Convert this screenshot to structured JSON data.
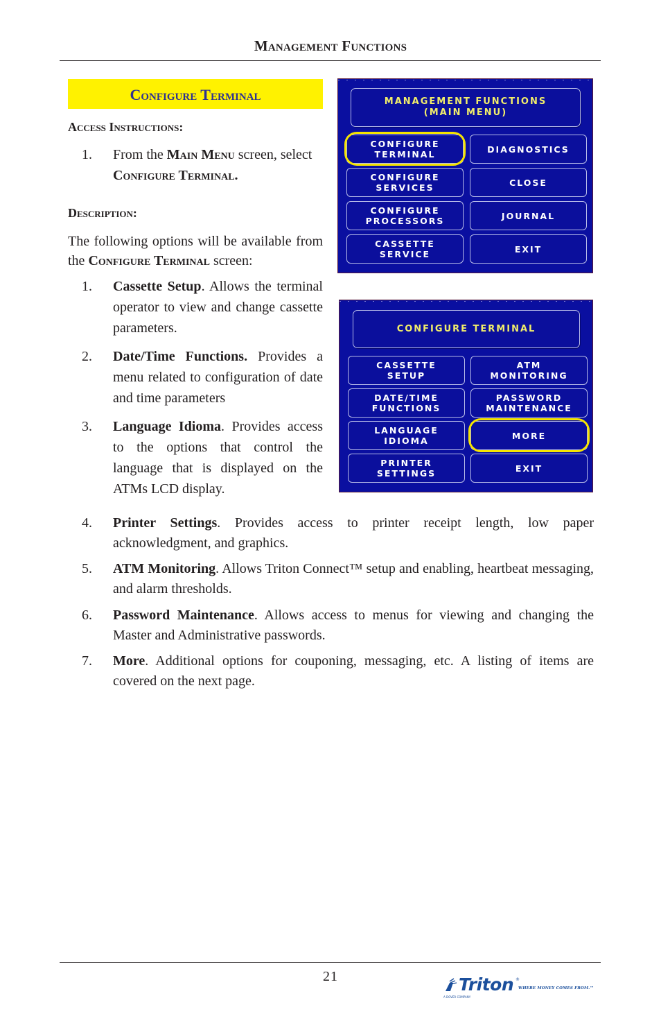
{
  "header": {
    "title": "Management Functions"
  },
  "section": {
    "title": "Configure Terminal"
  },
  "access": {
    "heading": "Access Instructions:",
    "steps": [
      {
        "num": "1.",
        "pre": "From the ",
        "sc1": "Main Menu",
        "mid": " screen, select ",
        "sc2": "Configure Terminal",
        "post": "."
      }
    ]
  },
  "description": {
    "heading": "Description:",
    "intro_pre": "The following options will be available from the ",
    "intro_sc": "Configure Terminal",
    "intro_post": " screen:",
    "items": [
      {
        "num": "1.",
        "bold": "Cassette Setup",
        "text": ". Allows the terminal operator to view and change cassette parameters."
      },
      {
        "num": "2.",
        "bold": "Date/Time Functions.",
        "text": " Provides a menu related to configuration of date and time parameters"
      },
      {
        "num": "3.",
        "bold": "Language Idioma",
        "text": ". Provides access to the options that control the language that is displayed on the ATMs LCD display."
      },
      {
        "num": "4.",
        "bold": "Printer Settings",
        "text": ". Provides access to printer receipt length, low paper acknowledgment, and graphics."
      },
      {
        "num": "5.",
        "bold": "ATM Monitoring",
        "text": ". Allows Triton Connect™ setup and enabling, heartbeat messaging, and alarm thresholds."
      },
      {
        "num": "6.",
        "bold": "Password Maintenance",
        "text": ". Allows access to menus for viewing and changing the Master and Administrative passwords."
      },
      {
        "num": "7.",
        "bold": "More",
        "text": ". Additional options for couponing, messaging, etc. A listing of items are covered on the next page."
      }
    ]
  },
  "screens": {
    "main_menu": {
      "title_line1": "MANAGEMENT FUNCTIONS",
      "title_line2": "(MAIN MENU)",
      "buttons": [
        {
          "line1": "CONFIGURE",
          "line2": "TERMINAL",
          "highlighted": true
        },
        {
          "line1": "DIAGNOSTICS",
          "line2": ""
        },
        {
          "line1": "CONFIGURE",
          "line2": "SERVICES"
        },
        {
          "line1": "CLOSE",
          "line2": ""
        },
        {
          "line1": "CONFIGURE",
          "line2": "PROCESSORS"
        },
        {
          "line1": "JOURNAL",
          "line2": ""
        },
        {
          "line1": "CASSETTE",
          "line2": "SERVICE"
        },
        {
          "line1": "EXIT",
          "line2": ""
        }
      ]
    },
    "configure_terminal": {
      "title_line1": "CONFIGURE TERMINAL",
      "buttons": [
        {
          "line1": "CASSETTE",
          "line2": "SETUP"
        },
        {
          "line1": "ATM",
          "line2": "MONITORING"
        },
        {
          "line1": "DATE/TIME",
          "line2": "FUNCTIONS"
        },
        {
          "line1": "PASSWORD",
          "line2": "MAINTENANCE"
        },
        {
          "line1": "LANGUAGE",
          "line2": "IDIOMA"
        },
        {
          "line1": "MORE",
          "line2": "",
          "highlighted": true
        },
        {
          "line1": "PRINTER",
          "line2": "SETTINGS"
        },
        {
          "line1": "EXIT",
          "line2": ""
        }
      ]
    },
    "colors": {
      "screen_bg": "#0a0fa0",
      "title_text": "#f2ee6a",
      "button_text": "#ffffff",
      "highlight_ring": "#f5e400"
    }
  },
  "footer": {
    "page_number": "21",
    "logo": {
      "wordmark": "Triton",
      "registered": "®",
      "tagline": "WHERE MONEY COMES FROM.™",
      "sub": "A DOVER COMPANY"
    }
  },
  "colors": {
    "banner_bg": "#fff200",
    "banner_text": "#2e3192",
    "logo_blue": "#1b4f9c"
  }
}
